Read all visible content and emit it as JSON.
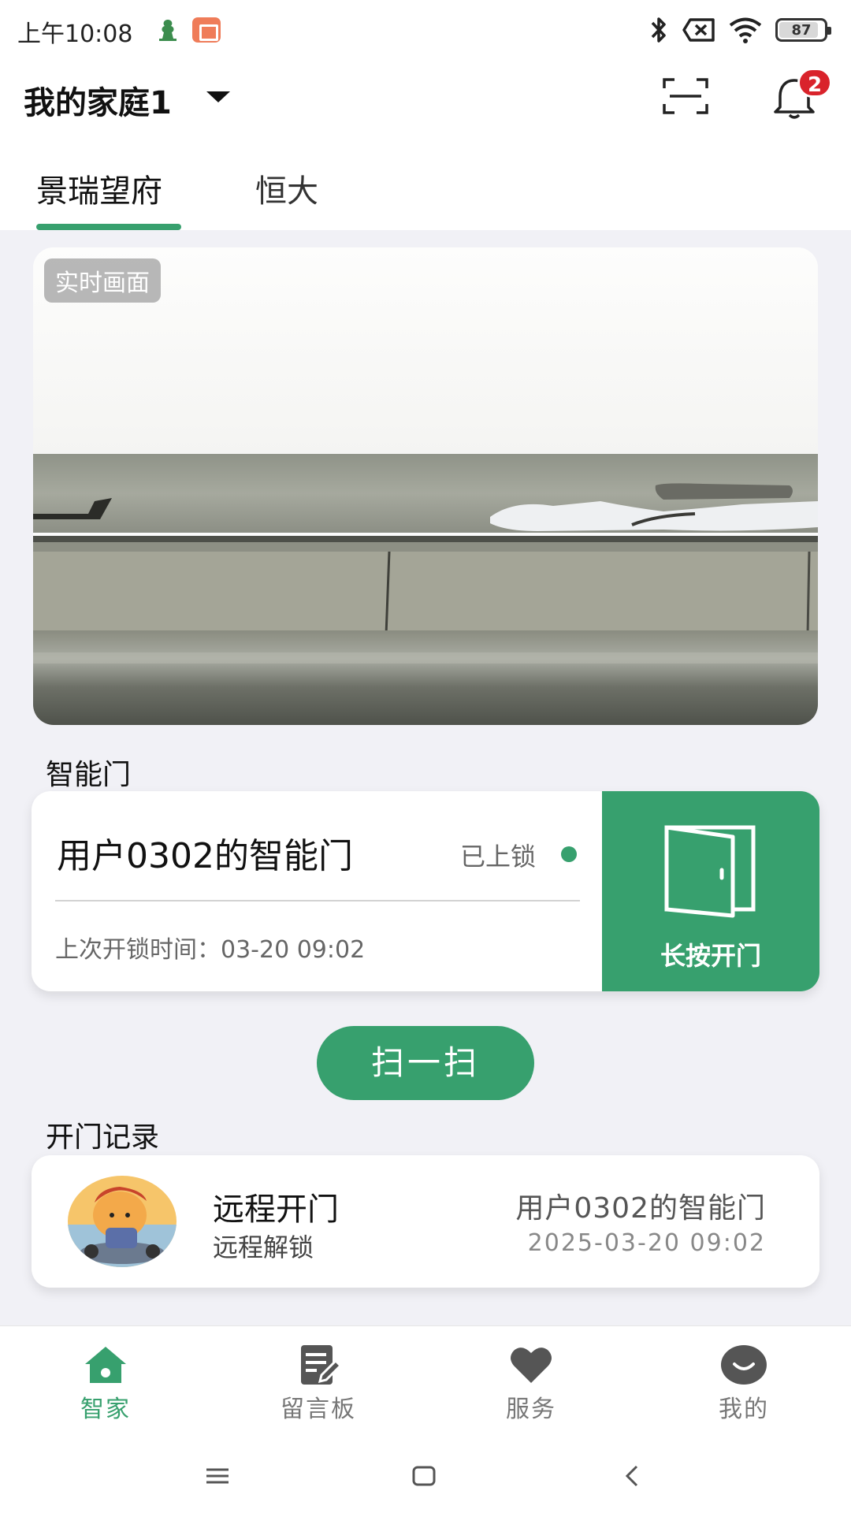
{
  "status_bar": {
    "time": "上午10:08",
    "battery": "87",
    "battery_level": 0.87
  },
  "header": {
    "family_title": "我的家庭1",
    "notification_count": "2"
  },
  "tabs": [
    {
      "label": "景瑞望府"
    },
    {
      "label": "恒大"
    }
  ],
  "camera": {
    "badge": "实时画面"
  },
  "smart_door": {
    "section_title": "智能门",
    "name": "用户0302的智能门",
    "status": "已上锁",
    "last_unlock": "上次开锁时间：03-20 09:02",
    "open_button_label": "长按开门"
  },
  "scan_button_label": "扫一扫",
  "records": {
    "section_title": "开门记录",
    "items": [
      {
        "type": "远程开门",
        "method": "远程解锁",
        "door": "用户0302的智能门",
        "time": "2025-03-20 09:02"
      }
    ]
  },
  "bottom_nav": [
    {
      "label": "智家",
      "icon": "home-icon"
    },
    {
      "label": "留言板",
      "icon": "note-edit-icon"
    },
    {
      "label": "服务",
      "icon": "heart-icon"
    },
    {
      "label": "我的",
      "icon": "profile-icon"
    }
  ],
  "colors": {
    "accent": "#37a06e",
    "badge": "#d9232b",
    "background": "#f1f1f6"
  }
}
